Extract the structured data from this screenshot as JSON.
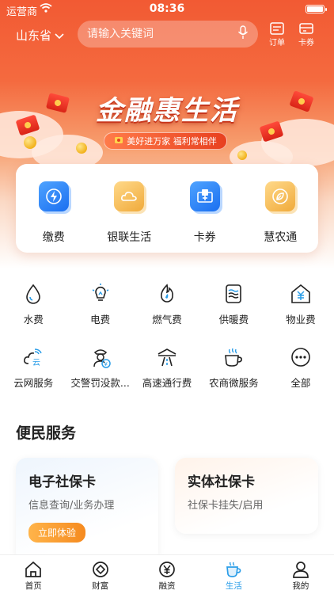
{
  "status_bar": {
    "carrier": "运营商",
    "time": "08:36"
  },
  "header": {
    "region": "山东省",
    "search_placeholder": "请输入关键词",
    "orders_label": "订单",
    "coupons_label": "卡券"
  },
  "banner": {
    "title": "金融惠生活",
    "subtitle": "美好进万家 福利常相伴"
  },
  "quick_actions": [
    {
      "label": "缴费",
      "icon": "bolt-icon"
    },
    {
      "label": "银联生活",
      "icon": "cloud-icon"
    },
    {
      "label": "卡券",
      "icon": "ticket-icon"
    },
    {
      "label": "慧农通",
      "icon": "leaf-icon"
    }
  ],
  "services": [
    {
      "label": "水费",
      "icon": "water-drop-icon"
    },
    {
      "label": "电费",
      "icon": "lightbulb-icon"
    },
    {
      "label": "燃气费",
      "icon": "flame-icon"
    },
    {
      "label": "供暖费",
      "icon": "heating-icon"
    },
    {
      "label": "物业费",
      "icon": "property-icon"
    },
    {
      "label": "云网服务",
      "icon": "cloud-wifi-icon"
    },
    {
      "label": "交警罚没款...",
      "icon": "police-icon"
    },
    {
      "label": "高速通行费",
      "icon": "toll-icon"
    },
    {
      "label": "农商微服务",
      "icon": "tea-cup-icon"
    },
    {
      "label": "全部",
      "icon": "more-icon"
    }
  ],
  "section": {
    "title": "便民服务"
  },
  "cards": {
    "left": {
      "title": "电子社保卡",
      "subtitle": "信息查询/业务办理",
      "button": "立即体验"
    },
    "right": {
      "title": "实体社保卡",
      "subtitle": "社保卡挂失/启用"
    }
  },
  "tabs": [
    {
      "label": "首页",
      "icon": "home-icon"
    },
    {
      "label": "财富",
      "icon": "wealth-icon"
    },
    {
      "label": "融资",
      "icon": "yuan-icon"
    },
    {
      "label": "生活",
      "icon": "coffee-icon",
      "active": true
    },
    {
      "label": "我的",
      "icon": "user-icon"
    }
  ],
  "colors": {
    "primary": "#f25a33",
    "accent_blue": "#2a9de8",
    "button_orange": "#f58a1f"
  }
}
